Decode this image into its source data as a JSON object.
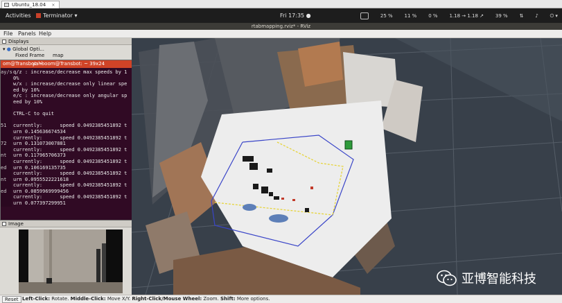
{
  "host_tab": {
    "label": "Ubuntu_18.04",
    "close": "×"
  },
  "gnome": {
    "activities": "Activities",
    "app_name": "Terminator ▾",
    "clock": "Fri 17:35 ●",
    "tray": [
      "25 %",
      "11 %",
      "0 %",
      "1.18 → 1.18 ↗",
      "39 %"
    ]
  },
  "rviz": {
    "window_title": "rtabmapping.rviz* - RViz"
  },
  "menu": [
    "File",
    "Panels",
    "Help"
  ],
  "displays_panel": {
    "title": "Displays",
    "global_options": "Global Opti...",
    "fixed_frame_label": "Fixed Frame",
    "fixed_frame_value": "map"
  },
  "terminal": {
    "title": "yahboom@Transbot: ~ 39x24",
    "left_title": "om@Transbot: ~",
    "gutter": [
      "ay/s",
      "",
      "",
      "",
      "",
      "",
      "",
      "",
      "",
      "51",
      "",
      "",
      "72",
      "",
      "nt",
      "",
      "ed",
      "",
      "nt",
      "",
      "ed",
      "",
      ""
    ],
    "lines": [
      "q/z : increase/decrease max speeds by 1",
      "0%",
      "w/x : increase/decrease only linear spe",
      "ed by 10%",
      "e/c : increase/decrease only angular sp",
      "eed by 10%",
      "",
      "CTRL-C to quit",
      "",
      "currently:      speed 0.0492385451892 t",
      "urn 0.145636674534",
      "currently:      speed 0.0492385451892 t",
      "urn 0.131073007881",
      "currently:      speed 0.0492385451892 t",
      "urn 0.117965706373",
      "currently:      speed 0.0492385451892 t",
      "urn 0.106169135735",
      "currently:      speed 0.0492385451892 t",
      "urn 0.0955522221618",
      "currently:      speed 0.0492385451892 t",
      "urn 0.0859969999456",
      "currently:      speed 0.0492385451892 t",
      "urn 0.077397299951"
    ]
  },
  "image_panel": {
    "title": "Image"
  },
  "status_bar": {
    "reset": "Reset",
    "left_click_key": "Left-Click:",
    "left_click_desc": " Rotate. ",
    "middle_click_key": "Middle-Click:",
    "middle_click_desc": " Move X/Y. ",
    "right_click_key": "Right-Click/Mouse Wheel:",
    "right_click_desc": " Zoom. ",
    "shift_key": "Shift:",
    "shift_desc": " More options."
  },
  "watermark": {
    "text": "亚博智能科技",
    "icon": "wechat-icon"
  },
  "colors": {
    "terminal_bg": "#300a24",
    "terminal_title": "#d04327",
    "gnome_bar": "#1d1d1d",
    "map_floor": "#eeeeee",
    "path_yellow": "#e6d43a",
    "path_blue": "#3a45c8"
  }
}
